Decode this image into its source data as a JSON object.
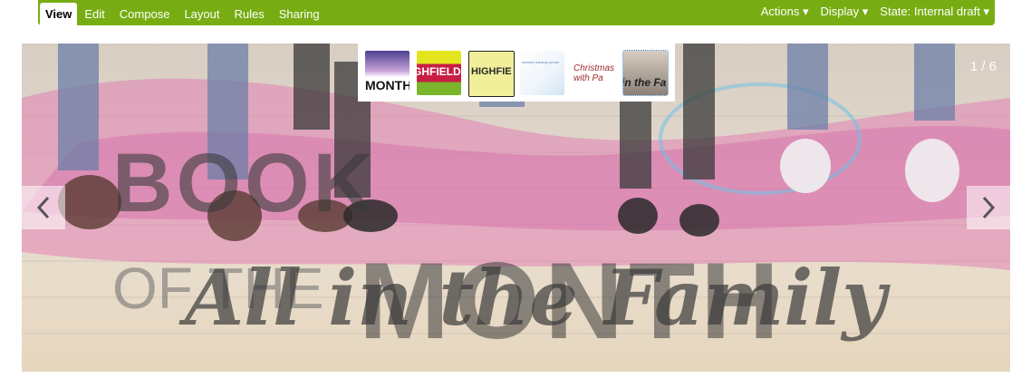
{
  "toolbar": {
    "tabs": [
      {
        "label": "View",
        "active": true
      },
      {
        "label": "Edit"
      },
      {
        "label": "Compose"
      },
      {
        "label": "Layout"
      },
      {
        "label": "Rules"
      },
      {
        "label": "Sharing"
      }
    ],
    "menus": {
      "actions": "Actions ▾",
      "display": "Display ▾",
      "state": "State: Internal draft ▾"
    },
    "accent_color": "#77ad13"
  },
  "slideshow": {
    "counter": "1 / 6",
    "prev_icon": "chevron-left-icon",
    "next_icon": "chevron-right-icon",
    "thumbnails": [
      {
        "text": "MONTH"
      },
      {
        "text": "GHFIELD"
      },
      {
        "text": "HIGHFIE"
      },
      {
        "text": "ministry training course"
      },
      {
        "text": "Christmas with Pa"
      },
      {
        "text": "in the Fa"
      }
    ],
    "artwork": {
      "line1": "BOOK",
      "line2": "OF THE",
      "line3": "MONTH",
      "script": "All in the Family"
    }
  }
}
